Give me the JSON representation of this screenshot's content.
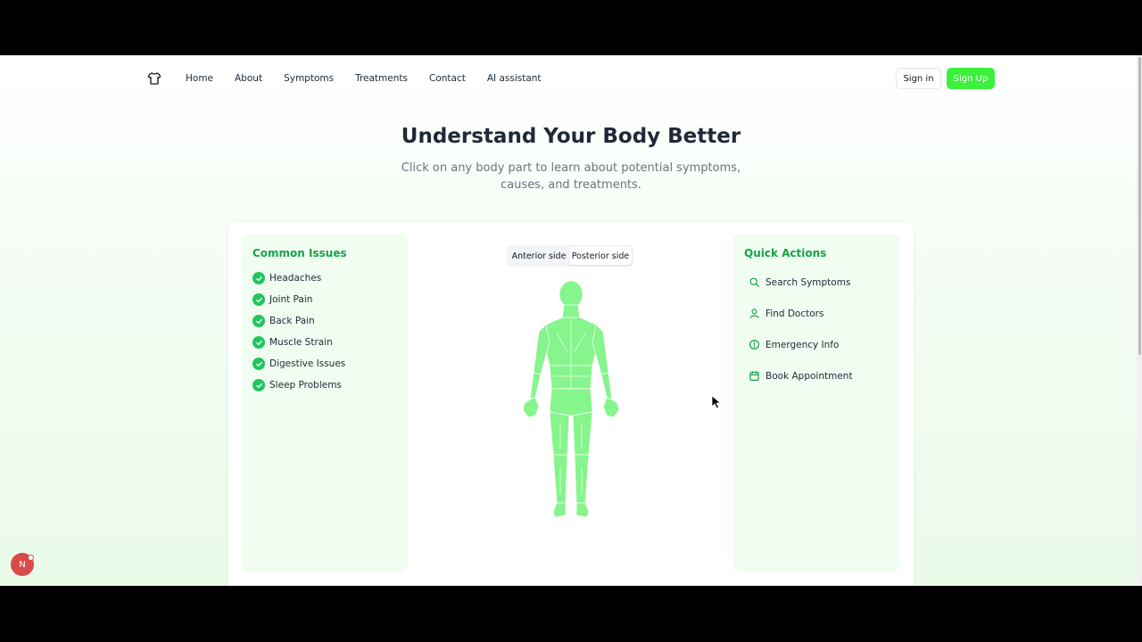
{
  "nav": {
    "logo_icon": "tshirt-icon",
    "links": [
      "Home",
      "About",
      "Symptoms",
      "Treatments",
      "Contact",
      "AI assistant"
    ],
    "signin_label": "Sign in",
    "signup_label": "Sign Up"
  },
  "hero": {
    "title": "Understand Your Body Better",
    "subtitle": "Click on any body part to learn about potential symptoms, causes, and treatments."
  },
  "common_issues": {
    "title": "Common Issues",
    "items": [
      "Headaches",
      "Joint Pain",
      "Back Pain",
      "Muscle Strain",
      "Digestive Issues",
      "Sleep Problems"
    ]
  },
  "view_toggle": {
    "options": [
      "Anterior side",
      "Posterior side"
    ],
    "selected": "Posterior side"
  },
  "quick_actions": {
    "title": "Quick Actions",
    "items": [
      {
        "label": "Search Symptoms",
        "icon": "search-icon"
      },
      {
        "label": "Find Doctors",
        "icon": "user-icon"
      },
      {
        "label": "Emergency Info",
        "icon": "alert-circle-icon"
      },
      {
        "label": "Book Appointment",
        "icon": "calendar-icon"
      }
    ]
  },
  "badge": {
    "label": "N"
  },
  "colors": {
    "accent": "#3cf03c",
    "heading_green": "#16a34a",
    "body_fill": "#86f58c",
    "panel_bg": "#f0fdf0"
  }
}
